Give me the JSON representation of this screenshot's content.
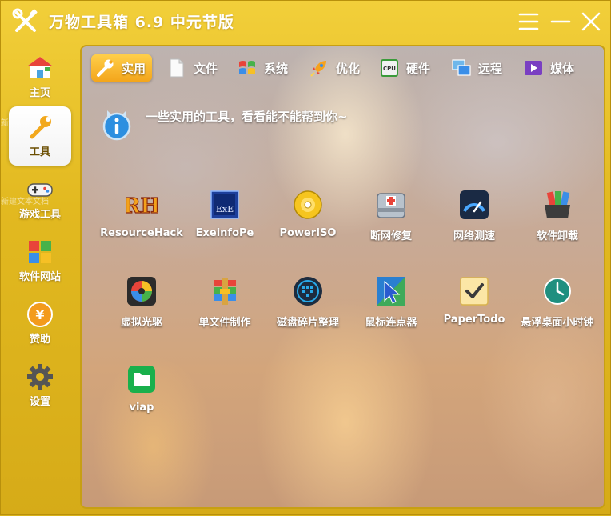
{
  "app": {
    "title": "万物工具箱 6.9 中元节版"
  },
  "sidebar": {
    "items": [
      {
        "label": "主页",
        "icon": "home-icon"
      },
      {
        "label": "工具",
        "icon": "wrench-icon",
        "active": true
      },
      {
        "label": "游戏工具",
        "icon": "gamepad-icon"
      },
      {
        "label": "软件网站",
        "icon": "windows-grid-icon"
      },
      {
        "label": "赞助",
        "icon": "yen-coin-icon"
      },
      {
        "label": "设置",
        "icon": "gear-icon"
      }
    ],
    "ghost_texts": [
      "新",
      "新建文本文档"
    ]
  },
  "tabs": [
    {
      "label": "实用",
      "icon": "wrench-icon",
      "active": true
    },
    {
      "label": "文件",
      "icon": "file-icon"
    },
    {
      "label": "系统",
      "icon": "windows-flag-icon"
    },
    {
      "label": "优化",
      "icon": "rocket-icon"
    },
    {
      "label": "硬件",
      "icon": "cpu-icon"
    },
    {
      "label": "远程",
      "icon": "remote-desktop-icon"
    },
    {
      "label": "媒体",
      "icon": "media-play-icon"
    }
  ],
  "info": {
    "text": "一些实用的工具，看看能不能帮到你~"
  },
  "tools": [
    {
      "label": "ResourceHack",
      "icon": "resourcehack-icon"
    },
    {
      "label": "ExeinfoPe",
      "icon": "exeinfo-icon"
    },
    {
      "label": "PowerISO",
      "icon": "disc-icon"
    },
    {
      "label": "断网修复",
      "icon": "network-repair-icon"
    },
    {
      "label": "网络测速",
      "icon": "speedometer-icon"
    },
    {
      "label": "软件卸载",
      "icon": "uninstall-icon"
    },
    {
      "label": "虚拟光驱",
      "icon": "virtual-drive-icon"
    },
    {
      "label": "单文件制作",
      "icon": "archive-books-icon"
    },
    {
      "label": "磁盘碎片整理",
      "icon": "defrag-icon"
    },
    {
      "label": "鼠标连点器",
      "icon": "mouse-cursor-icon"
    },
    {
      "label": "PaperTodo",
      "icon": "checkbox-note-icon"
    },
    {
      "label": "悬浮桌面小时钟",
      "icon": "clock-icon"
    },
    {
      "label": "viap",
      "icon": "folder-icon"
    }
  ],
  "colors": {
    "window_bg": "#e2b920",
    "tab_active": "#f3a51b",
    "text_light": "#ffffff"
  }
}
